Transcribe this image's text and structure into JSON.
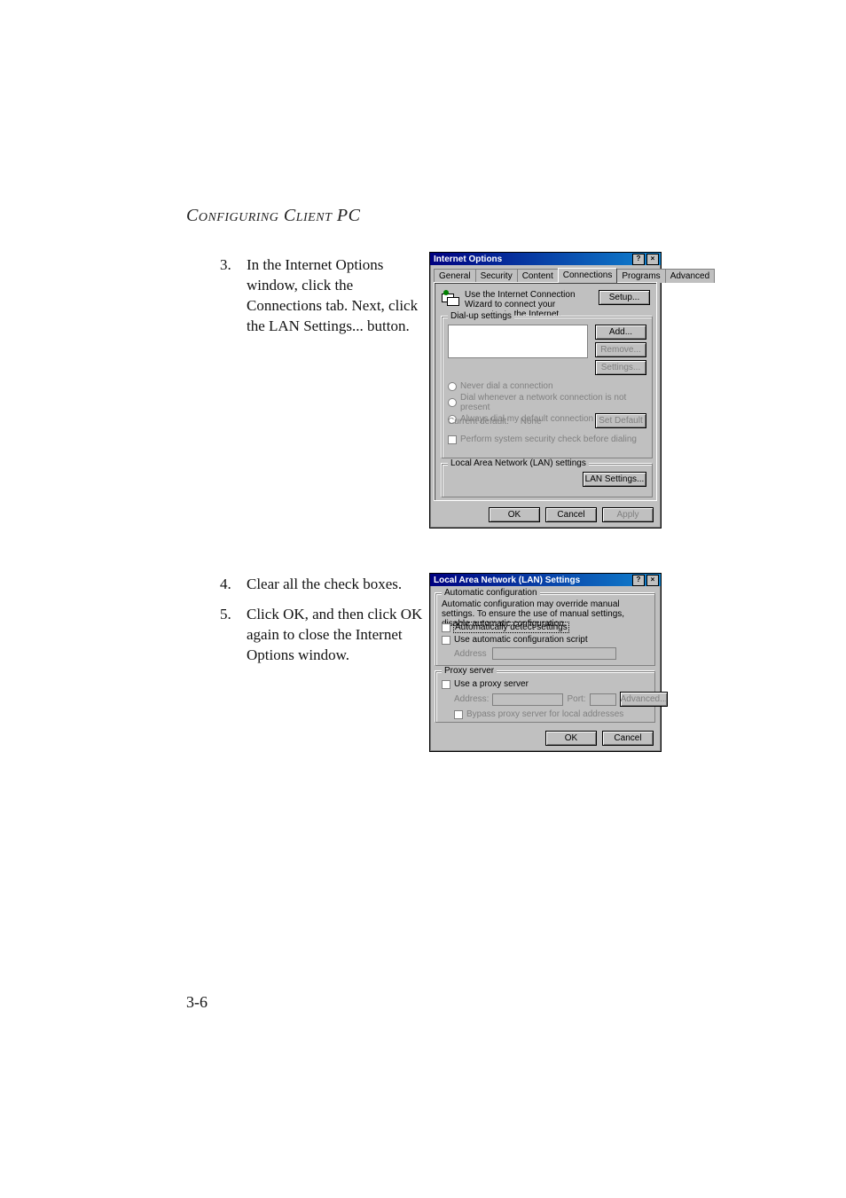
{
  "page": {
    "section_title": "Configuring Client PC",
    "page_number": "3-6"
  },
  "steps": {
    "s3": {
      "num": "3.",
      "text": "In the Internet Options window, click the Connections tab. Next, click the LAN Settings... button."
    },
    "s4": {
      "num": "4.",
      "text": "Clear all the check boxes."
    },
    "s5": {
      "num": "5.",
      "text": "Click OK, and then click OK again to close the Internet Options window."
    }
  },
  "internet_options": {
    "title": "Internet Options",
    "tabs": [
      "General",
      "Security",
      "Content",
      "Connections",
      "Programs",
      "Advanced"
    ],
    "wizard_hint": "Use the Internet Connection Wizard to connect your computer to the Internet.",
    "setup_btn": "Setup...",
    "dialup_group": "Dial-up settings",
    "add_btn": "Add...",
    "remove_btn": "Remove...",
    "settings_btn": "Settings...",
    "radio_never": "Never dial a connection",
    "radio_when": "Dial whenever a network connection is not present",
    "radio_always": "Always dial my default connection",
    "current_default_label": "Current default:",
    "current_default_value": "None",
    "set_default_btn": "Set Default",
    "perform_check": "Perform system security check before dialing",
    "lan_group": "Local Area Network (LAN) settings",
    "lan_btn": "LAN Settings...",
    "ok": "OK",
    "cancel": "Cancel",
    "apply": "Apply"
  },
  "lan_settings": {
    "title": "Local Area Network (LAN) Settings",
    "auto_group": "Automatic configuration",
    "auto_hint": "Automatic configuration may override manual settings. To ensure the use of manual settings, disable automatic configuration.",
    "auto_detect": "Automatically detect settings",
    "auto_script": "Use automatic configuration script",
    "address_label": "Address",
    "proxy_group": "Proxy server",
    "use_proxy": "Use a proxy server",
    "proxy_address_label": "Address:",
    "proxy_port_label": "Port:",
    "advanced_btn": "Advanced...",
    "bypass": "Bypass proxy server for local addresses",
    "ok": "OK",
    "cancel": "Cancel"
  }
}
